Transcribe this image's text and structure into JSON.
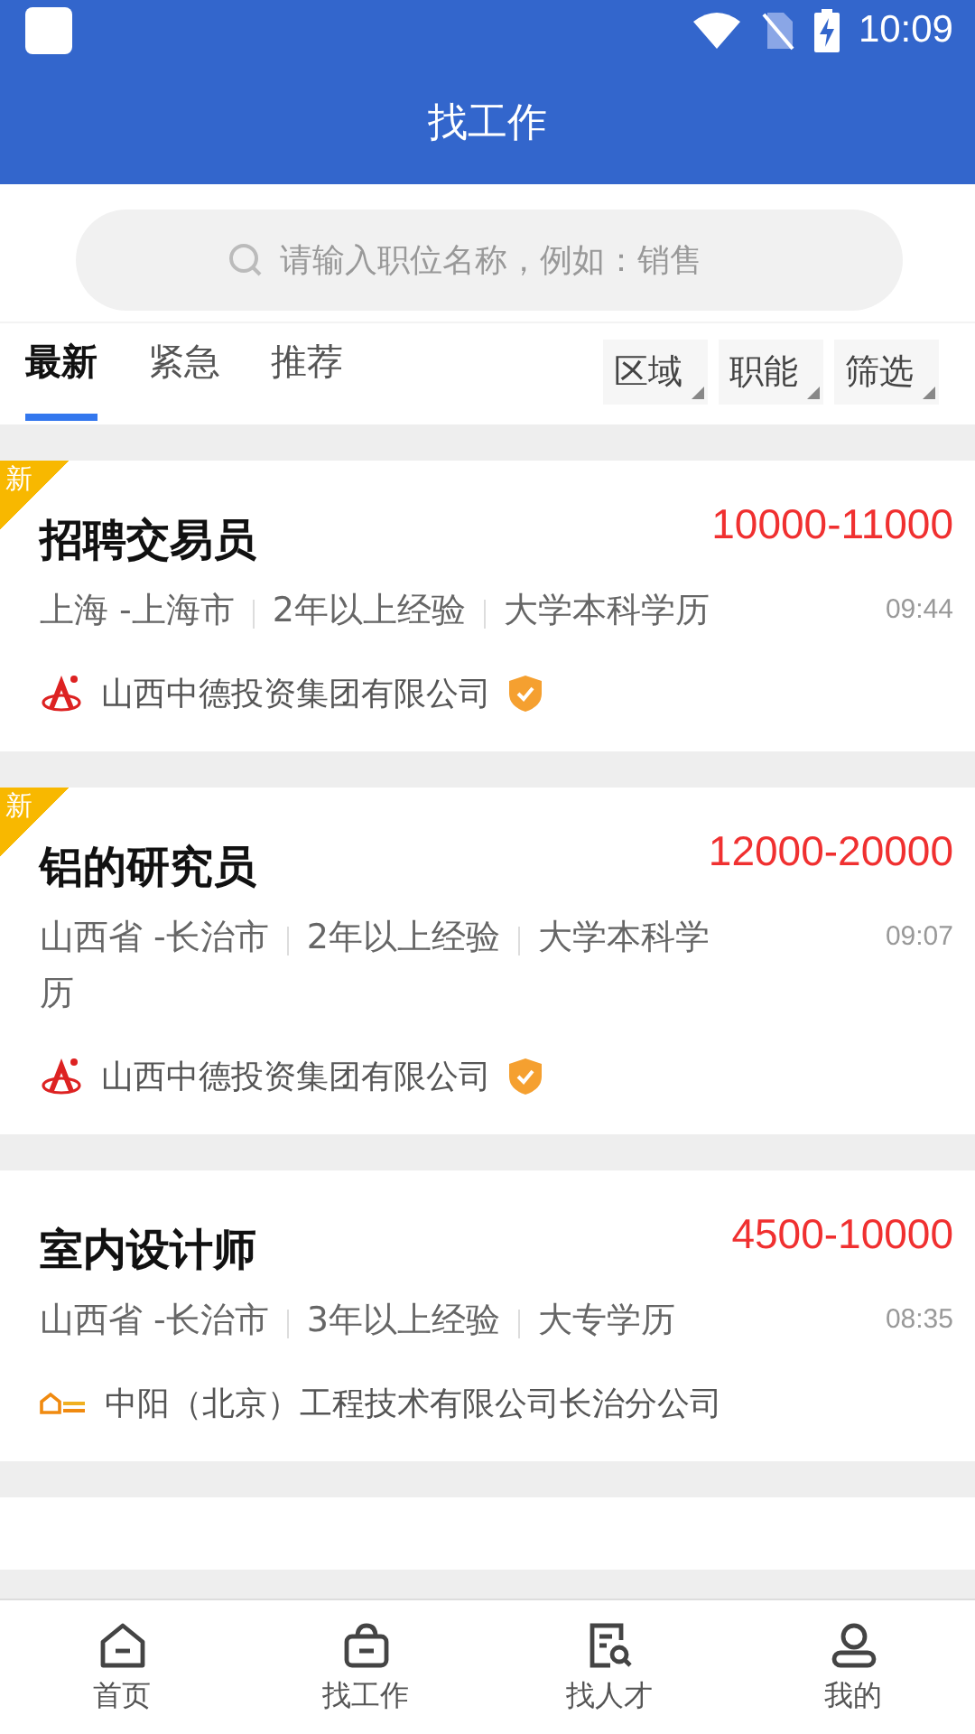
{
  "status_bar": {
    "time": "10:09"
  },
  "header": {
    "title": "找工作"
  },
  "search": {
    "placeholder": "请输入职位名称，例如：销售"
  },
  "tabs": [
    {
      "label": "最新",
      "selected": true
    },
    {
      "label": "紧急",
      "selected": false
    },
    {
      "label": "推荐",
      "selected": false
    }
  ],
  "filters": [
    "区域",
    "职能",
    "筛选"
  ],
  "jobs": [
    {
      "is_new": true,
      "badge": "新",
      "title": "招聘交易员",
      "salary": "10000-11000",
      "meta": [
        "上海 -上海市",
        "2年以上经验",
        "大学本科学历"
      ],
      "time": "09:44",
      "company": "山西中德投资集团有限公司",
      "logo": {
        "kind": "figure"
      },
      "verified": true
    },
    {
      "is_new": true,
      "badge": "新",
      "title": "铝的研究员",
      "salary": "12000-20000",
      "meta": [
        "山西省 -长治市",
        "2年以上经验",
        "大学本科学历"
      ],
      "time": "09:07",
      "company": "山西中德投资集团有限公司",
      "logo": {
        "kind": "figure"
      },
      "verified": true
    },
    {
      "is_new": false,
      "title": "室内设计师",
      "salary": "4500-10000",
      "meta": [
        "山西省 -长治市",
        "3年以上经验",
        "大专学历"
      ],
      "time": "08:35",
      "company": "中阳（北京）工程技术有限公司长治分公司",
      "logo": {
        "kind": "house"
      },
      "verified": false
    }
  ],
  "bottom_nav": [
    {
      "label": "首页",
      "kind": "home"
    },
    {
      "label": "找工作",
      "kind": "briefcase"
    },
    {
      "label": "找人才",
      "kind": "search"
    },
    {
      "label": "我的",
      "kind": "person"
    }
  ]
}
